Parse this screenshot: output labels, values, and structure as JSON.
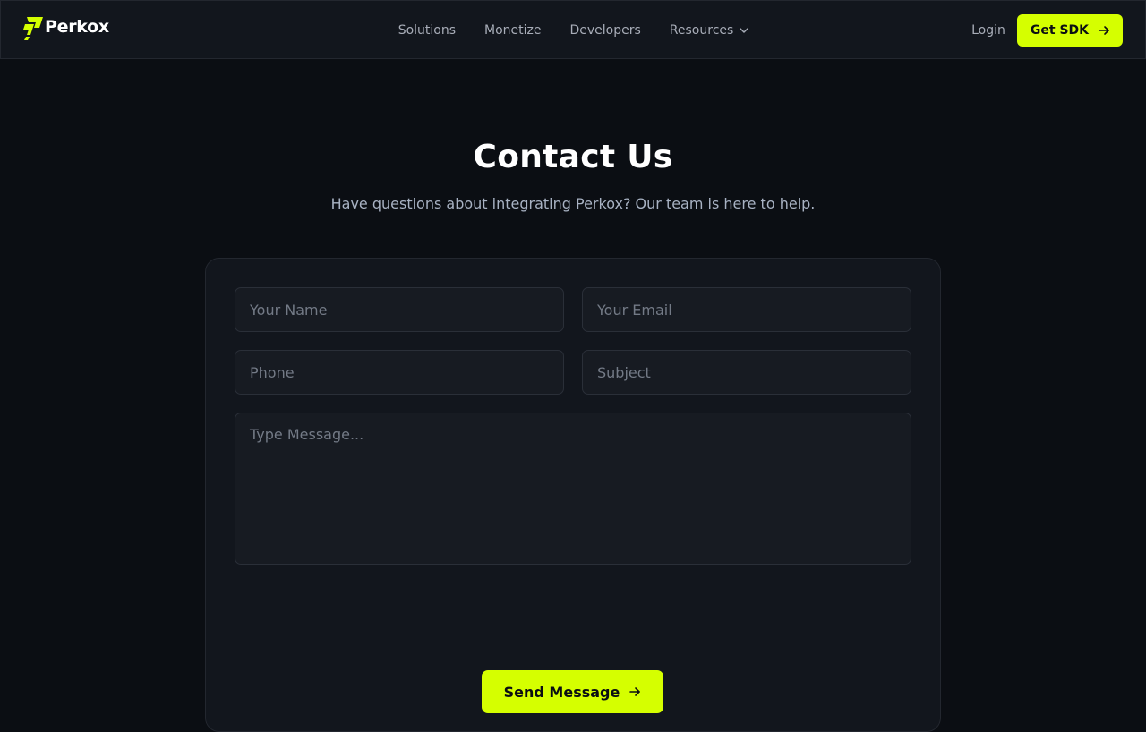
{
  "brand": {
    "name": "Perkox",
    "logo_icon": "perkox-logo-icon",
    "accent_color": "#d5ff00"
  },
  "nav": {
    "items": [
      {
        "label": "Solutions"
      },
      {
        "label": "Monetize"
      },
      {
        "label": "Developers"
      },
      {
        "label": "Resources",
        "icon": "chevron-down-icon"
      }
    ],
    "login_label": "Login",
    "cta_label": "Get SDK",
    "cta_icon": "arrow-right-icon"
  },
  "hero": {
    "title": "Contact Us",
    "subtitle": "Have questions about integrating Perkox? Our team is here to help."
  },
  "form": {
    "name_placeholder": "Your Name",
    "email_placeholder": "Your Email",
    "phone_placeholder": "Phone",
    "subject_placeholder": "Subject",
    "message_placeholder": "Type Message...",
    "submit_label": "Send Message",
    "submit_icon": "arrow-right-icon"
  }
}
